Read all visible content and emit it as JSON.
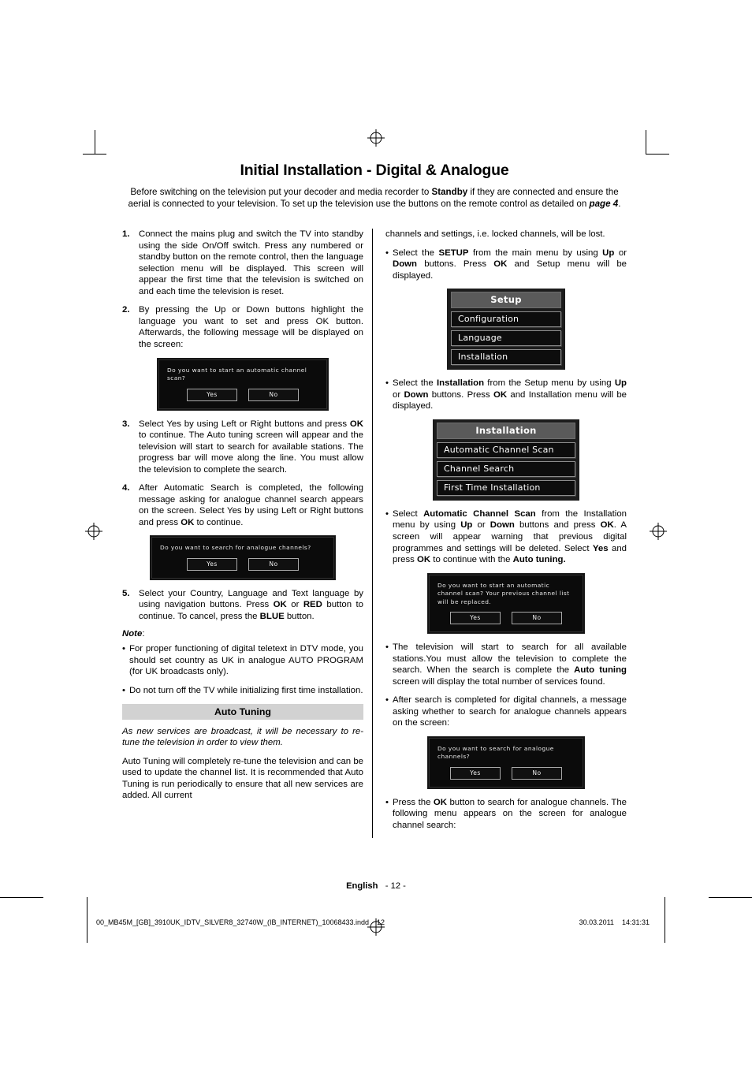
{
  "document": {
    "title": "Initial Installation - Digital & Analogue",
    "intro": {
      "part1": "Before switching on the television put your decoder and media recorder to ",
      "bold1": "Standby",
      "part2": " if they are connected and ensure the aerial is connected to your television. To set up the television use the buttons on the remote control as detailed on ",
      "bolditalic1": "page 4",
      "part3": "."
    }
  },
  "left_column": {
    "steps": [
      {
        "num": "1.",
        "text": "Connect the mains plug and switch the TV into standby using the side On/Off switch. Press any numbered or standby button on the remote control, then the language selection menu will be displayed. This screen will appear the first time that the television is switched on and each time the television is reset."
      },
      {
        "num": "2.",
        "text": "By pressing the Up or Down buttons highlight the language you want to set and press OK button. Afterwards, the following message will be displayed on the screen:"
      }
    ],
    "dialog_1": {
      "name": "automatic-channel-scan-dialog",
      "message": "Do you want to start an automatic channel scan?",
      "yes_label": "Yes",
      "no_label": "No"
    },
    "step3": {
      "num": "3.",
      "pre": "Select Yes by using Left or Right buttons and press ",
      "bold1": "OK",
      "post": " to continue. The Auto tuning screen will appear and the television will start to search for available stations. The progress bar will move along the line. You must allow the television to complete the search."
    },
    "step4": {
      "num": "4.",
      "pre": "After Automatic Search is completed, the following message asking for analogue channel search appears on the screen. Select Yes by using Left or Right buttons and press ",
      "bold1": "OK",
      "post": " to continue."
    },
    "dialog_2": {
      "name": "analogue-channel-search-dialog",
      "message": "Do you want to search for analogue channels?",
      "yes_label": "Yes",
      "no_label": "No"
    },
    "step5": {
      "num": "5.",
      "pre": "Select your Country, Language and Text language by using navigation buttons. Press ",
      "bold1": "OK",
      "mid1": " or ",
      "bold2": "RED",
      "mid2": " button to continue. To cancel, press the ",
      "bold3": "BLUE",
      "post": " button."
    },
    "note_label": "Note",
    "note_colon": ":",
    "notes": [
      "For proper functioning of digital teletext in DTV mode, you should set country as UK in analogue AUTO PROGRAM (for UK broadcasts only).",
      "Do not turn off the TV while initializing first time installation."
    ],
    "section_title": "Auto Tuning",
    "section_italic": "As new services are broadcast, it will be necessary to re-tune the television in order to view them.",
    "section_para": "Auto Tuning will completely re-tune the television and can be used to update the channel list. It is recommended that Auto Tuning is run periodically to ensure that all new services are added. All current"
  },
  "right_column": {
    "continuation": "channels and settings, i.e. locked channels, will be lost.",
    "bullet_setup": {
      "pre": "Select the ",
      "bold1": "SETUP",
      "mid1": " from the main menu by using ",
      "bold2": "Up",
      "mid2": " or ",
      "bold3": "Down",
      "mid3": " buttons. Press ",
      "bold4": "OK",
      "post": " and Setup menu will be displayed."
    },
    "setup_menu": {
      "name": "setup-menu",
      "title": "Setup",
      "items": [
        "Configuration",
        "Language",
        "Installation"
      ]
    },
    "bullet_installation": {
      "pre": "Select the ",
      "bold1": "Installation",
      "mid1": " from the Setup menu by using ",
      "bold2": "Up",
      "mid2": " or ",
      "bold3": "Down",
      "mid3": " buttons. Press ",
      "bold4": "OK",
      "post": " and Installation menu will be displayed."
    },
    "installation_menu": {
      "name": "installation-menu",
      "title": "Installation",
      "items": [
        "Automatic Channel Scan",
        "Channel Search",
        "First Time Installation"
      ]
    },
    "bullet_scan": {
      "pre": "Select ",
      "bold1": "Automatic Channel Scan",
      "mid1": " from the Installation menu by using ",
      "bold2": "Up",
      "mid2": " or ",
      "bold3": "Down",
      "mid3": " buttons and press ",
      "bold4": "OK",
      "mid4": ". A screen will appear warning that previous digital programmes and settings will be deleted. Select ",
      "bold5": "Yes",
      "mid5": " and press ",
      "bold6": "OK",
      "mid6": " to continue with the ",
      "bold7": "Auto tuning.",
      "post": ""
    },
    "dialog_3": {
      "name": "replace-channel-list-dialog",
      "message": "Do you want to start an automatic channel scan? Your previous channel list will be replaced.",
      "yes_label": "Yes",
      "no_label": "No"
    },
    "bullet_search": {
      "pre": "The television will start to search for all available stations.You must allow the television to complete the search. When the search is complete the ",
      "bold1": "Auto tuning",
      "post": " screen will display the total number of services found."
    },
    "bullet_after": "After search is completed for digital channels, a message asking whether to search for analogue channels appears on the screen:",
    "dialog_4": {
      "name": "analogue-channel-search-dialog-2",
      "message": "Do you want to search for analogue channels?",
      "yes_label": "Yes",
      "no_label": "No"
    },
    "bullet_press_ok": {
      "pre": "Press the ",
      "bold1": "OK",
      "post": " button to search for analogue channels. The following menu appears on the screen for analogue channel search:"
    }
  },
  "footer": {
    "language": "English",
    "page_number": "- 12 -",
    "print_file": "00_MB45M_[GB]_3910UK_IDTV_SILVER8_32740W_(IB_INTERNET)_10068433.indd",
    "print_page": "12",
    "print_date": "30.03.2011",
    "print_time": "14:31:31"
  }
}
